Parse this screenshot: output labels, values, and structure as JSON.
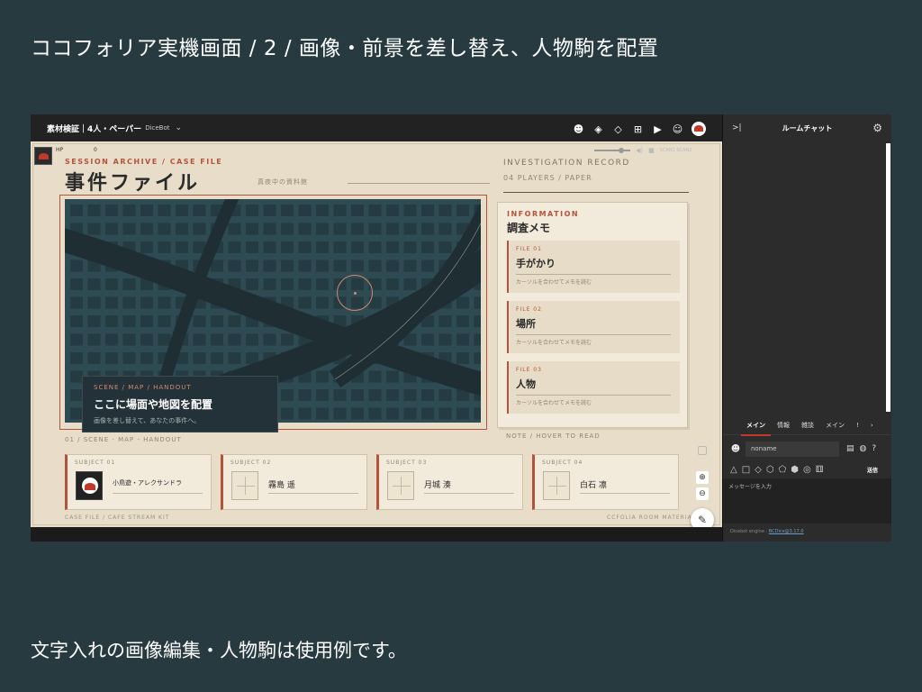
{
  "heading": "ココフォリア実機画面 / 2 / 画像・前景を差し替え、人物駒を配置",
  "footer": "文字入れの画像編集・人物駒は使用例です。",
  "toolbar": {
    "room_name": "素材検証｜4人・ペーパー",
    "dicebot": "DiceBot",
    "caret": "⌄",
    "icons": [
      "character-icon",
      "layers-icon",
      "layers-alt-icon",
      "add-note-icon",
      "screen-icon",
      "emoji-icon",
      "user-avatar-icon"
    ]
  },
  "board": {
    "hp_label": "HP",
    "hp_value": "0",
    "session_label": "SESSION ARCHIVE / CASE FILE",
    "case_title": "事件ファイル",
    "night_label": "真夜中の資料館",
    "volume_level": 0.75,
    "volume_labels": "SCAN1  SCAN2",
    "investigation_record": "INVESTIGATION RECORD",
    "players_paper": "04 PLAYERS / PAPER",
    "scene_eyebrow": "SCENE / MAP / HANDOUT",
    "scene_title": "ここに場面や地図を配置",
    "scene_desc": "画像を差し替えて、あなたの事件へ。",
    "map_caption": "01 / SCENE - MAP - HANDOUT",
    "note_caption": "NOTE / HOVER TO READ",
    "info_eyebrow": "INFORMATION",
    "info_title": "調査メモ",
    "files": [
      {
        "num": "FILE 01",
        "title": "手がかり",
        "hint": "カーソルを合わせてメモを読む"
      },
      {
        "num": "FILE 02",
        "title": "場所",
        "hint": "カーソルを合わせてメモを読む"
      },
      {
        "num": "FILE 03",
        "title": "人物",
        "hint": "カーソルを合わせてメモを読む"
      }
    ],
    "subjects": [
      {
        "label": "SUBJECT 01",
        "name": "小鳥遊・アレクサンドラ"
      },
      {
        "label": "SUBJECT 02",
        "name": "霧島 遥"
      },
      {
        "label": "SUBJECT 03",
        "name": "月城 湊"
      },
      {
        "label": "SUBJECT 04",
        "name": "白石 凛"
      }
    ],
    "foot_left": "CASE FILE / CAFE STREAM KIT",
    "foot_right": "CCFOLIA ROOM MATERIAL"
  },
  "chat": {
    "collapse": ">|",
    "title": "ルームチャット",
    "tabs": [
      "メイン",
      "情報",
      "雑談",
      "メイン",
      "!"
    ],
    "tabs_more": "›",
    "name_value": "noname",
    "send_label": "送信",
    "message_placeholder": "メッセージを入力",
    "engine_label": "Dicebot engine : ",
    "engine_link": "BCDice@3.17.0"
  },
  "colors": {
    "background": "#263a3f",
    "accent": "#b4533b",
    "board": "#e7ddc9",
    "map": "#2e4a52",
    "chat": "#2c2c2c"
  }
}
